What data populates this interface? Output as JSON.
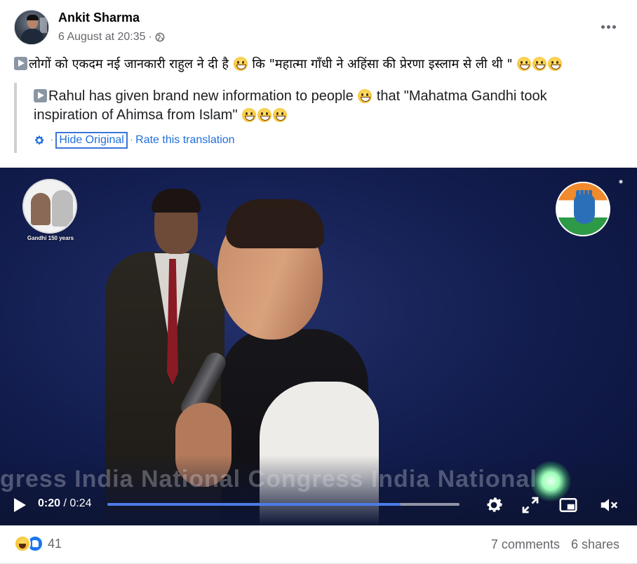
{
  "post": {
    "author": "Ankit Sharma",
    "timestamp": "6 August at 20:35",
    "separator": "·",
    "audience_icon": "globe-icon",
    "more_icon": "more-options-icon"
  },
  "text": {
    "original_part1": "लोगों को एकदम नई जानकारी राहुल ने दी है",
    "original_part2": "कि \"महात्मा गाँधी ने अहिंसा की प्रेरणा इस्लाम  से ली थी \"",
    "translated_part1": "Rahul has given brand new information to people",
    "translated_part2": "that \"Mahatma Gandhi took inspiration of Ahimsa from Islam\""
  },
  "translation_controls": {
    "hide_original": "Hide Original",
    "separator": "·",
    "rate": "Rate this translation"
  },
  "video": {
    "current_time": "0:20",
    "time_separator": " / ",
    "duration": "0:24",
    "progress_fraction": 0.833,
    "watermark": "gress    India  National Congress     India National",
    "left_logo_caption": "Gandhi 150 years",
    "colors": {
      "progress": "#4b7be8",
      "background": "#141f52"
    }
  },
  "footer": {
    "reaction_count": "41",
    "comments": "7 comments",
    "shares": "6 shares"
  }
}
